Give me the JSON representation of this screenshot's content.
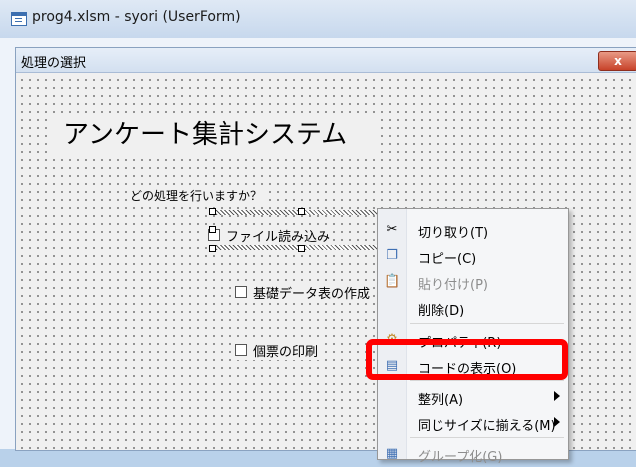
{
  "window": {
    "title": "prog4.xlsm - syori (UserForm)",
    "icon": "userform-window-icon"
  },
  "form": {
    "title": "処理の選択",
    "close_label": "x",
    "heading": "アンケート集計システム",
    "question": "どの処理を行いますか？",
    "options": [
      {
        "label": "ファイル読み込み",
        "checked": false
      },
      {
        "label": "基礎データ表の作成",
        "checked": false
      },
      {
        "label": "個票の印刷",
        "checked": false
      }
    ]
  },
  "context_menu": {
    "items": [
      {
        "label": "切り取り(T)",
        "icon": "scissors-icon",
        "enabled": true
      },
      {
        "label": "コピー(C)",
        "icon": "copy-icon",
        "enabled": true
      },
      {
        "label": "貼り付け(P)",
        "icon": "paste-icon",
        "enabled": false
      },
      {
        "label": "削除(D)",
        "icon": "",
        "enabled": true
      },
      {
        "label": "プロパティ(R)",
        "icon": "properties-icon",
        "enabled": true
      },
      {
        "label": "コードの表示(O)",
        "icon": "code-view-icon",
        "enabled": true
      },
      {
        "label": "整列(A)",
        "icon": "",
        "enabled": true,
        "submenu": true
      },
      {
        "label": "同じサイズに揃える(M)",
        "icon": "",
        "enabled": true,
        "submenu": true
      },
      {
        "label": "グループ化(G)",
        "icon": "group-icon",
        "enabled": true
      }
    ]
  },
  "highlight_color": "#ff0000"
}
